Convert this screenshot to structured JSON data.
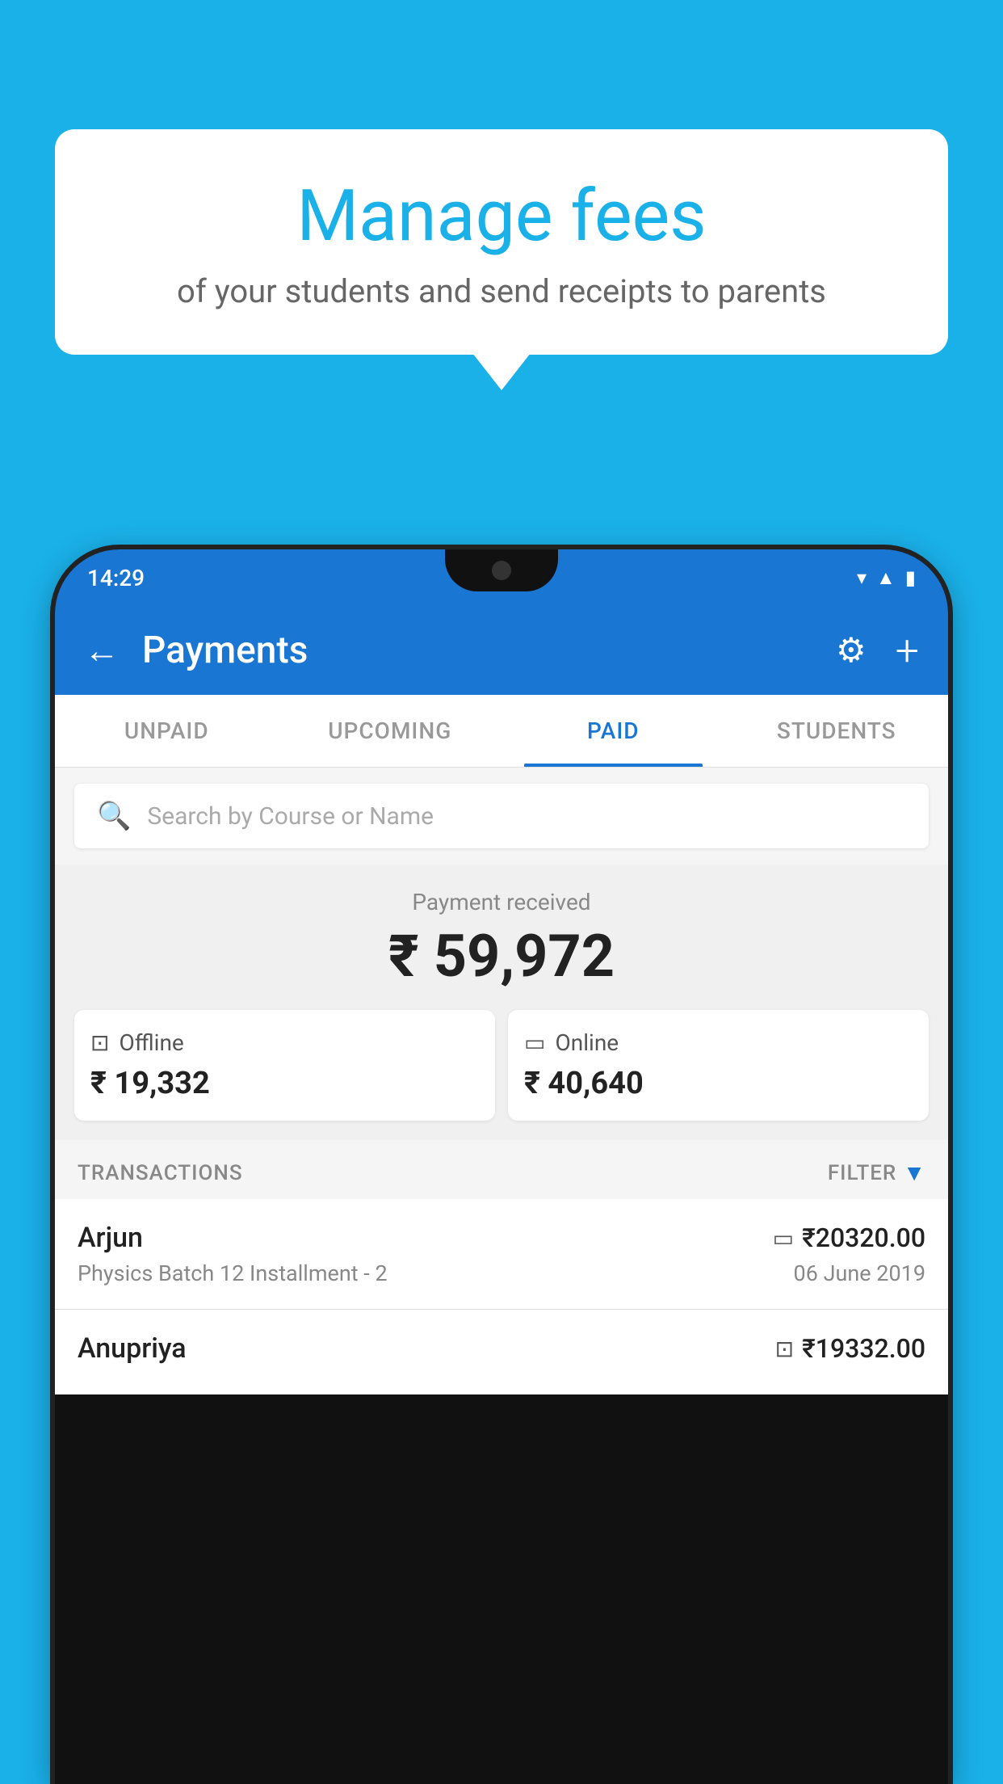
{
  "background_color": "#1ab0e8",
  "bubble": {
    "title": "Manage fees",
    "subtitle": "of your students and send receipts to parents"
  },
  "status_bar": {
    "time": "14:29",
    "icons": [
      "wifi",
      "signal",
      "battery"
    ]
  },
  "app_bar": {
    "title": "Payments",
    "back_label": "←",
    "settings_label": "⚙",
    "add_label": "+"
  },
  "tabs": [
    {
      "label": "UNPAID",
      "active": false
    },
    {
      "label": "UPCOMING",
      "active": false
    },
    {
      "label": "PAID",
      "active": true
    },
    {
      "label": "STUDENTS",
      "active": false
    }
  ],
  "search": {
    "placeholder": "Search by Course or Name"
  },
  "payment_section": {
    "label": "Payment received",
    "amount": "₹ 59,972",
    "offline": {
      "type": "Offline",
      "amount": "₹ 19,332"
    },
    "online": {
      "type": "Online",
      "amount": "₹ 40,640"
    }
  },
  "transactions": {
    "header_label": "TRANSACTIONS",
    "filter_label": "FILTER",
    "rows": [
      {
        "name": "Arjun",
        "course": "Physics Batch 12 Installment - 2",
        "amount": "₹20320.00",
        "date": "06 June 2019",
        "type": "online"
      },
      {
        "name": "Anupriya",
        "course": "",
        "amount": "₹19332.00",
        "date": "",
        "type": "offline"
      }
    ]
  }
}
